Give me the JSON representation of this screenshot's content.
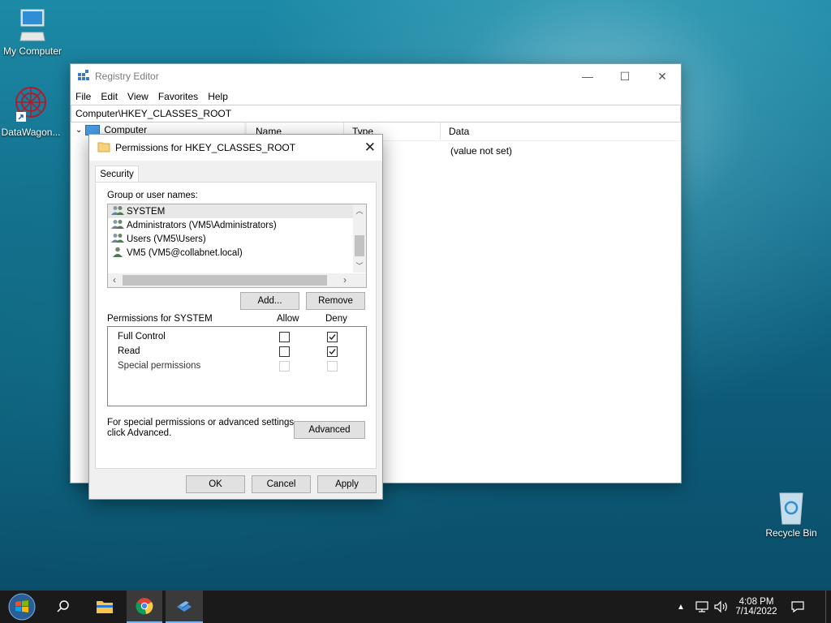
{
  "desktop": {
    "icons": [
      {
        "label": "My Computer"
      },
      {
        "label": "DataWagon..."
      },
      {
        "label": "Recycle Bin"
      }
    ]
  },
  "registry": {
    "title": "Registry Editor",
    "menu": [
      "File",
      "Edit",
      "View",
      "Favorites",
      "Help"
    ],
    "address": "Computer\\HKEY_CLASSES_ROOT",
    "tree_root": "Computer",
    "columns": [
      "Name",
      "Type",
      "Data"
    ],
    "row_data": "(value not set)"
  },
  "dialog": {
    "title": "Permissions for HKEY_CLASSES_ROOT",
    "tab": "Security",
    "group_label": "Group or user names:",
    "users": [
      {
        "name": "SYSTEM",
        "icon": "group-icon"
      },
      {
        "name": "Administrators (VM5\\Administrators)",
        "icon": "group-icon"
      },
      {
        "name": "Users (VM5\\Users)",
        "icon": "group-icon"
      },
      {
        "name": "VM5 (VM5@collabnet.local)",
        "icon": "user-icon"
      }
    ],
    "add_label": "Add...",
    "remove_label": "Remove",
    "perm_header": "Permissions for SYSTEM",
    "allow_header": "Allow",
    "deny_header": "Deny",
    "permissions": [
      {
        "name": "Full Control",
        "allow": false,
        "deny": true,
        "enabled": true
      },
      {
        "name": "Read",
        "allow": false,
        "deny": true,
        "enabled": true
      },
      {
        "name": "Special permissions",
        "allow": false,
        "deny": false,
        "enabled": false
      }
    ],
    "advanced_note_1": "For special permissions or advanced settings,",
    "advanced_note_2": "click Advanced.",
    "advanced_label": "Advanced",
    "ok_label": "OK",
    "cancel_label": "Cancel",
    "apply_label": "Apply"
  },
  "taskbar": {
    "time": "4:08 PM",
    "date": "7/14/2022"
  }
}
